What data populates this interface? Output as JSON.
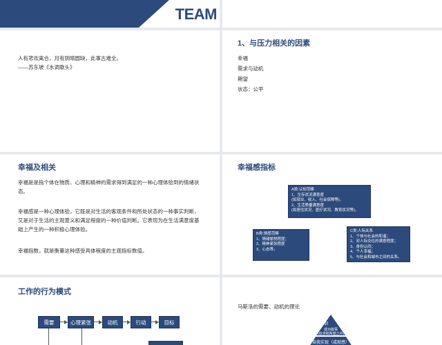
{
  "slide0": {
    "team": "TEAM"
  },
  "slide1": {
    "quote_line1": "人有悲欢离合，月有阴晴圆缺，此事古难全。",
    "quote_line2": "——苏东坡《水调歌头》"
  },
  "slide2": {
    "title": "1、与压力相关的因素",
    "items": [
      "幸福",
      "需求与动机",
      "期望",
      "状态：公平"
    ]
  },
  "slide3": {
    "title": "幸福及相关",
    "para1": "幸福是是指个体在物质、心理和精神的需求得到满足的一种心理体验到的情绪状态。",
    "para2": "幸福感是一种心理体验，它既是对生活的客观条件和所处状态的一种事实判断，又是对于生活的主观意义和满足程度的一种价值判断。它表现为在生活满意度基础上产生的一种积极心理体验。",
    "para3": "幸福指数，就是衡量这种感受具体程度的主观指标数值。"
  },
  "slide4": {
    "title": "幸福感指标",
    "boxA": [
      "A类:认知范畴",
      "1、生存状况满意度",
      "(如就业、收入、社会保障等),",
      "2、生活质量满意度",
      "(如居住状况、医疗状况、教育状况等)。"
    ],
    "boxB": [
      "B类:情感范畴",
      "1、情绪愉悦程度；",
      "2、精神紧张程度",
      "3、心态等。"
    ],
    "boxC": [
      "C类:人际关系",
      "1、个体与社会的和谐；",
      "2、对人际交往的满意程度；",
      "3、身份认同；",
      "4、个人幸福；",
      "5、与社会和城市之间的关系。"
    ]
  },
  "slide5": {
    "title": "工作的行为模式",
    "flow": [
      "需要",
      "心理紧张",
      "动机",
      "行动",
      "目标"
    ]
  },
  "slide6": {
    "subtitle": "马斯洛的需要、动机的理论",
    "pyramid_top": "培训",
    "pyramid_top_sub1": "成功故事",
    "pyramid_top_sub2": "(追求和希望之中)",
    "pyramid_mid": "自我实现（成就感）"
  },
  "colors": {
    "primary": "#2c4a7c",
    "background": "#e8e9ed"
  }
}
